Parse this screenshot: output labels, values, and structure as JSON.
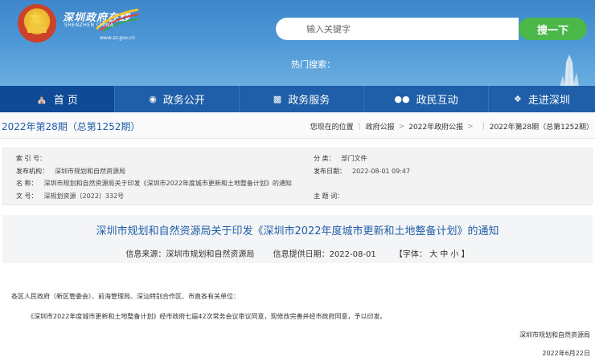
{
  "header": {
    "logo_cn": "深圳政府在线",
    "logo_en": "SHENZHEN CHINA",
    "logo_url": "www.sz.gov.cn",
    "search_placeholder": "输入关键字",
    "search_button": "搜一下",
    "hot_search_label": "热门搜索："
  },
  "nav": {
    "items": [
      {
        "label": "首 页",
        "icon": "home-icon"
      },
      {
        "label": "政务公开",
        "icon": "eye-icon"
      },
      {
        "label": "政务服务",
        "icon": "monitor-icon"
      },
      {
        "label": "政民互动",
        "icon": "people-icon"
      },
      {
        "label": "走进深圳",
        "icon": "info-icon"
      }
    ]
  },
  "issue_label": "2022年第28期（总第1252期）",
  "breadcrumb": {
    "prefix": "您现在的位置",
    "items": [
      "政府公报",
      "2022年政府公报",
      "2022年第28期（总第1252期）"
    ]
  },
  "info": {
    "index_label": "索 引 号：",
    "index_value": "",
    "category_label": "分 类：",
    "category_value": "部门文件",
    "issuer_label": "发布机构：",
    "issuer_value": "深圳市规划和自然资源局",
    "date_label": "发布日期：",
    "date_value": "2022-08-01 09:47",
    "name_label": "名 称：",
    "name_value": "深圳市规划和自然资源局关于印发《深圳市2022年度城市更新和土地整备计划》的通知",
    "docno_label": "文 号：",
    "docno_value": "深规划资源〔2022〕332号",
    "subject_label": "主 题 词：",
    "subject_value": ""
  },
  "article": {
    "title": "深圳市规划和自然资源局关于印发《深圳市2022年度城市更新和土地整备计划》的通知",
    "source": "信息来源：深圳市规划和自然资源局",
    "provided_date": "信息提供日期：2022-08-01",
    "font_size": "【字体： 大  中  小 】",
    "salutation": "各区人民政府（新区管委会）、前海管理局、深汕特别合作区、市直各有关单位：",
    "paragraph": "《深圳市2022年度城市更新和土地整备计划》经市政府七届42次常务会议审议同意，现修改完善并经市政府同意，予以印发。",
    "signer": "深圳市规划和自然资源局",
    "sign_date": "2022年6月22日"
  },
  "colors": {
    "header_blue": "#4d96d6",
    "nav_blue": "#1f5ea8",
    "search_green": "#4cb849",
    "link_blue": "#1f5ea8"
  }
}
